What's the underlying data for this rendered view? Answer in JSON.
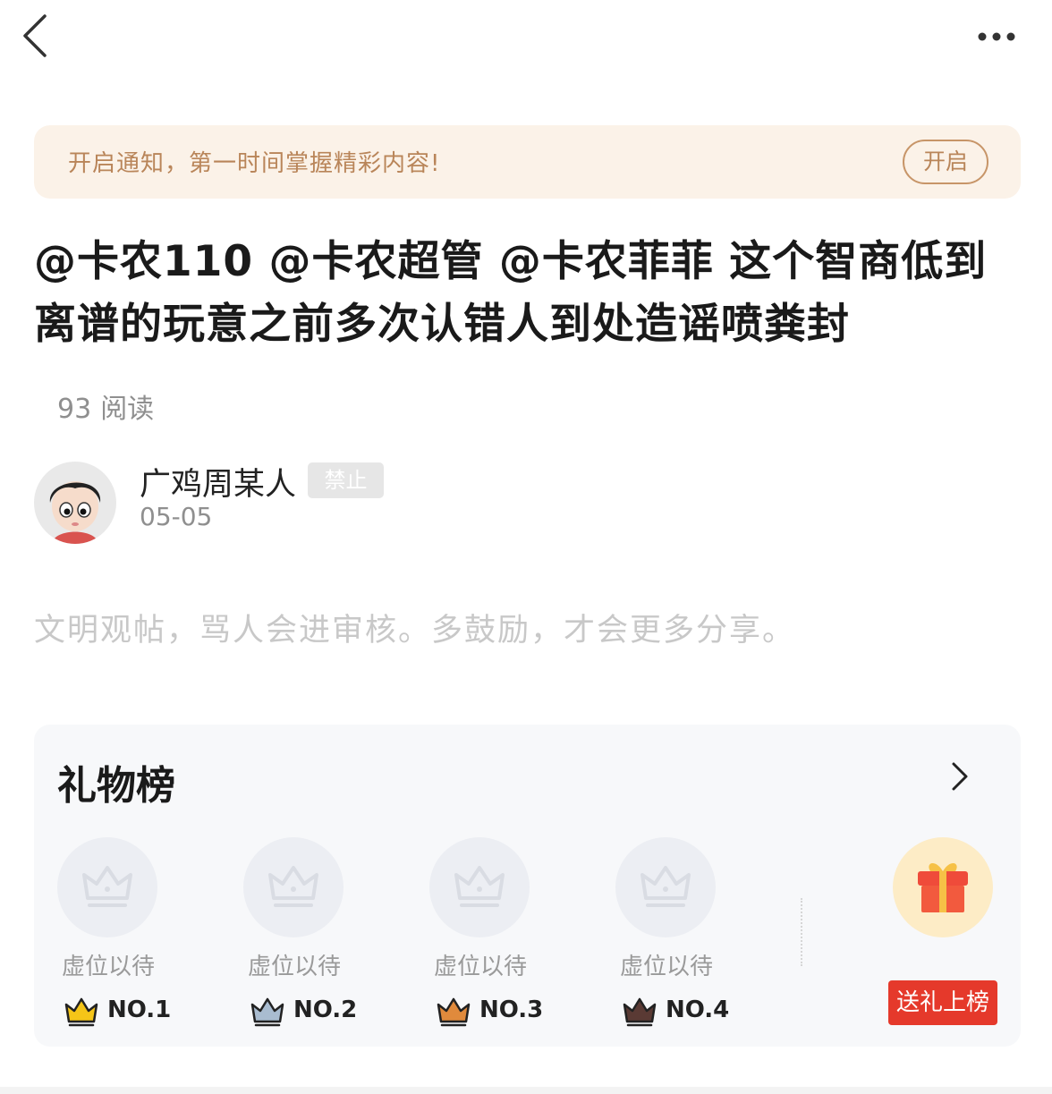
{
  "topbar": {
    "back_icon": "chevron-left-icon",
    "more_icon": "more-horizontal-icon"
  },
  "notify": {
    "text": "开启通知，第一时间掌握精彩内容!",
    "button": "开启"
  },
  "post": {
    "title": "@卡农110 @卡农超管 @卡农菲菲 这个智商低到离谱的玩意之前多次认错人到处造谣喷粪封",
    "read_count": "93",
    "read_label": "阅读"
  },
  "author": {
    "name": "广鸡周某人",
    "badge": "禁止",
    "date": "05-05",
    "avatar_icon": "cartoon-avatar-icon"
  },
  "body_hint": "文明观帖，骂人会进审核。多鼓励，才会更多分享。",
  "gift_board": {
    "title": "礼物榜",
    "slots": [
      {
        "label": "虚位以待",
        "rank": "NO.1",
        "crown_color": "#f5c518"
      },
      {
        "label": "虚位以待",
        "rank": "NO.2",
        "crown_color": "#a9bcd0"
      },
      {
        "label": "虚位以待",
        "rank": "NO.3",
        "crown_color": "#e08a3c"
      },
      {
        "label": "虚位以待",
        "rank": "NO.4",
        "crown_color": "#5a3a34"
      }
    ],
    "send_button": "送礼上榜"
  },
  "colors": {
    "notify_bg": "#fbf2e8",
    "notify_text": "#b98559",
    "send_button_bg": "#e5392b",
    "panel_bg": "#f7f8fa"
  }
}
